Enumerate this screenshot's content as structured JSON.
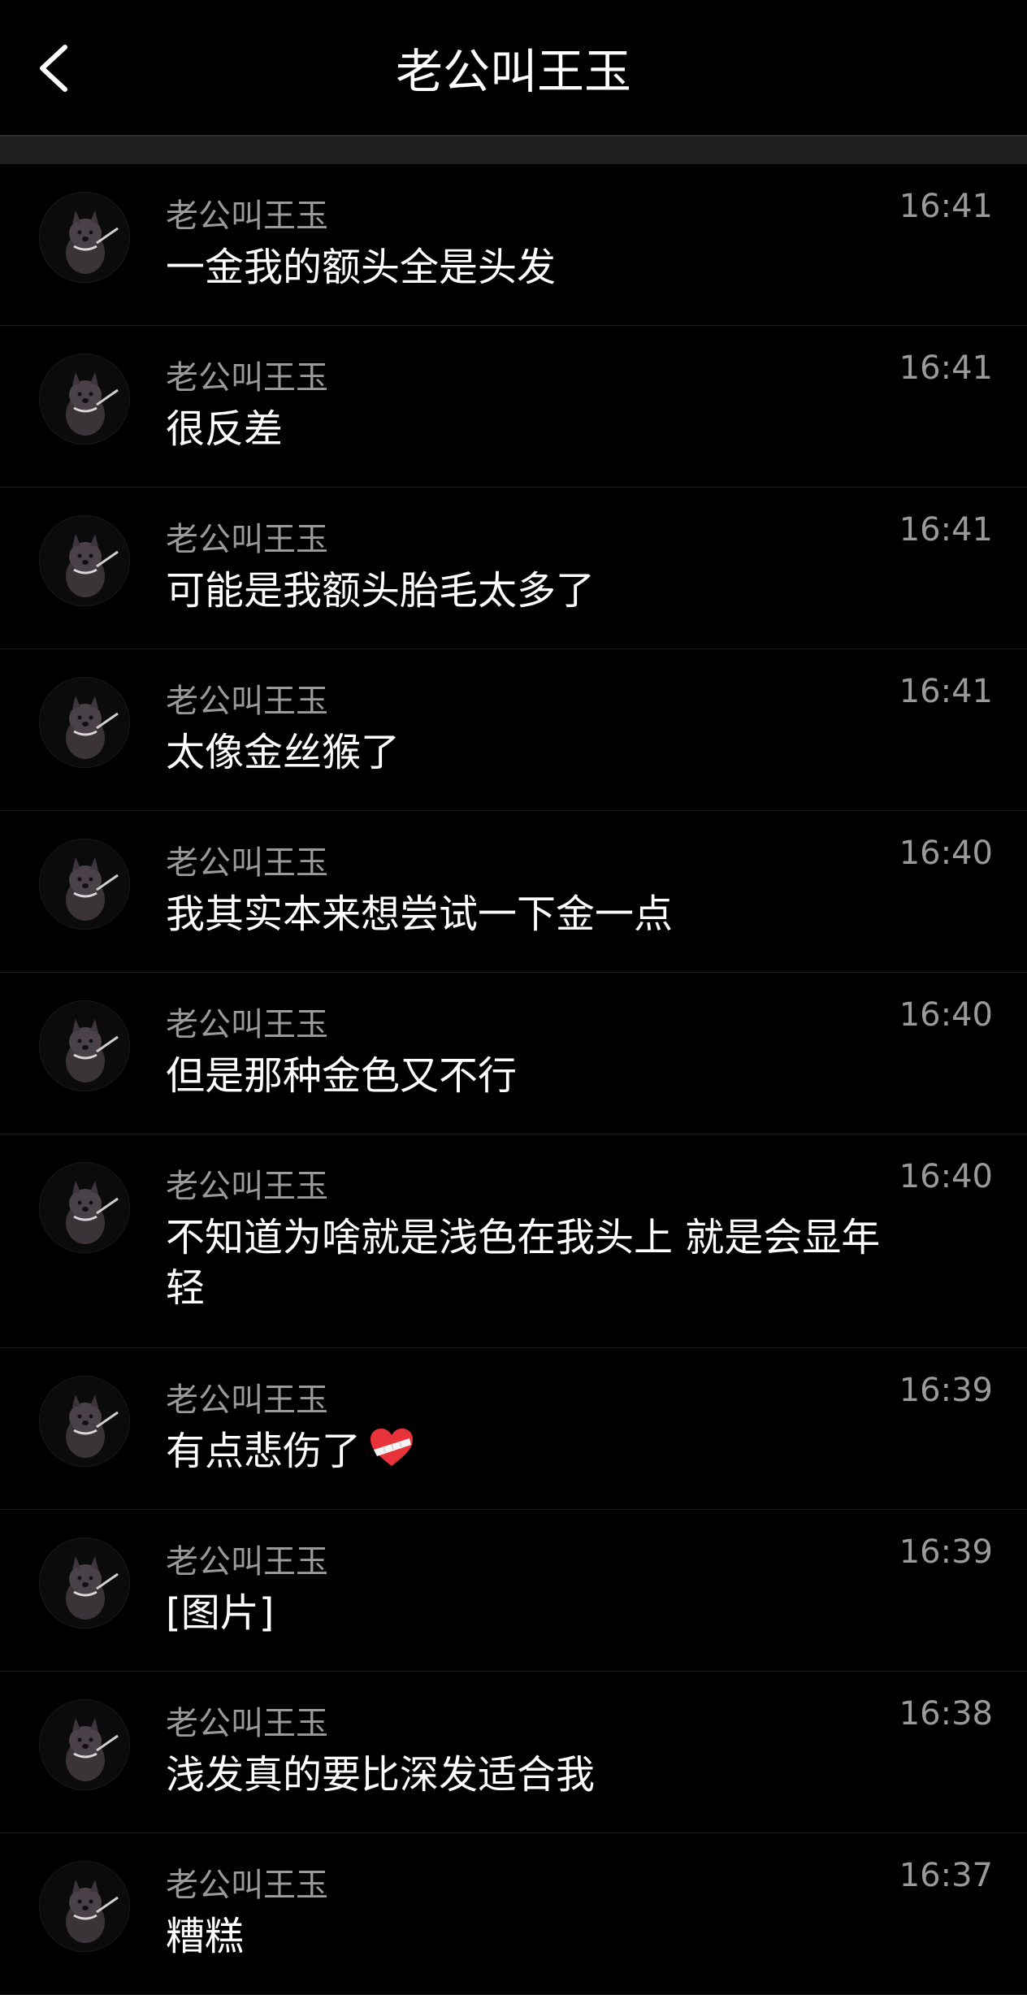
{
  "header": {
    "title": "老公叫王玉",
    "back_icon": "chevron-left-icon"
  },
  "messages": [
    {
      "sender": "老公叫王玉",
      "text": "一金我的额头全是头发",
      "time": "16:41"
    },
    {
      "sender": "老公叫王玉",
      "text": "很反差",
      "time": "16:41"
    },
    {
      "sender": "老公叫王玉",
      "text": "可能是我额头胎毛太多了",
      "time": "16:41"
    },
    {
      "sender": "老公叫王玉",
      "text": "太像金丝猴了",
      "time": "16:41"
    },
    {
      "sender": "老公叫王玉",
      "text": "我其实本来想尝试一下金一点",
      "time": "16:40"
    },
    {
      "sender": "老公叫王玉",
      "text": "但是那种金色又不行",
      "time": "16:40"
    },
    {
      "sender": "老公叫王玉",
      "text": "不知道为啥就是浅色在我头上 就是会显年轻",
      "time": "16:40"
    },
    {
      "sender": "老公叫王玉",
      "text": "有点悲伤了",
      "emoji": "bandaged-heart-icon",
      "time": "16:39"
    },
    {
      "sender": "老公叫王玉",
      "text": "[图片]",
      "time": "16:39"
    },
    {
      "sender": "老公叫王玉",
      "text": "浅发真的要比深发适合我",
      "time": "16:38"
    },
    {
      "sender": "老公叫王玉",
      "text": "糟糕",
      "time": "16:37"
    }
  ],
  "colors": {
    "background": "#000000",
    "text_primary": "#ffffff",
    "text_secondary": "#9a9a9a",
    "divider": "#1f1f1f",
    "heart": "#e8333a"
  },
  "avatar_icon": "black-dog-avatar-icon"
}
